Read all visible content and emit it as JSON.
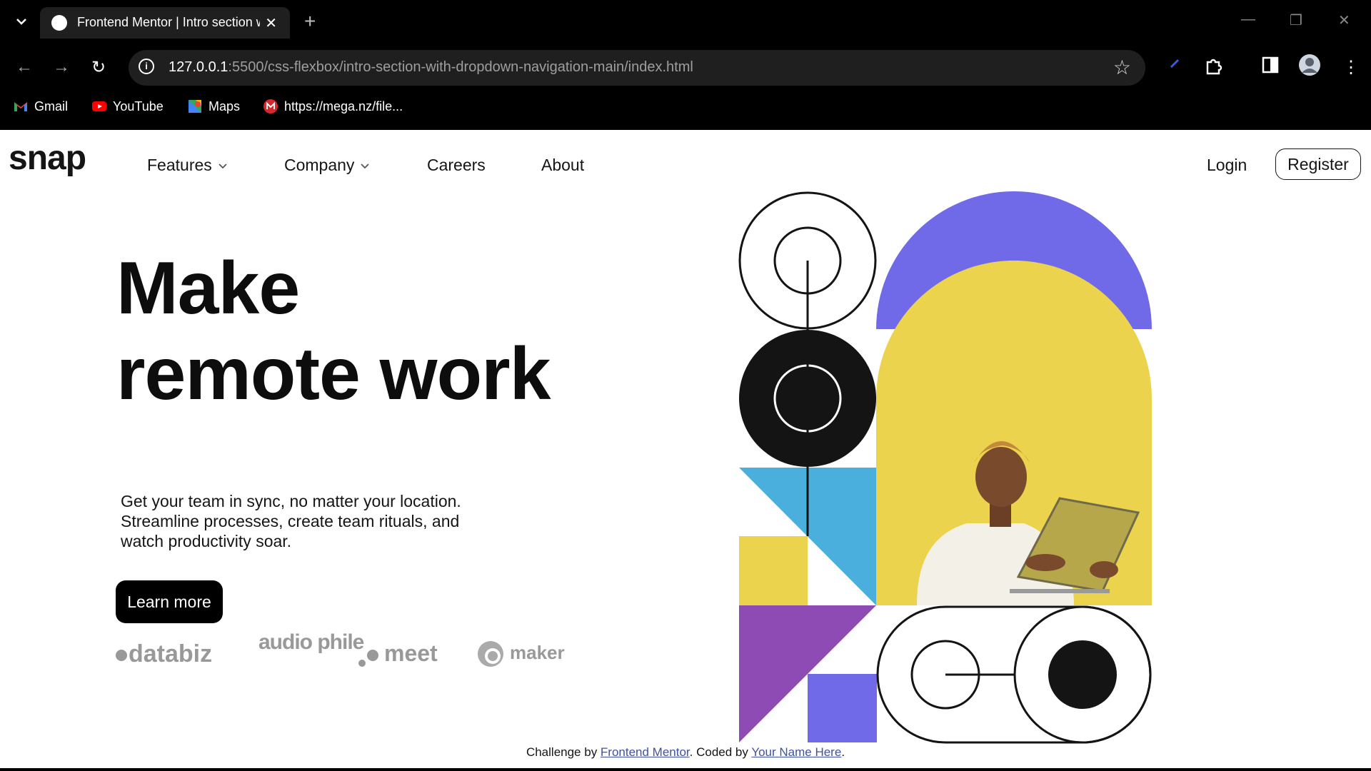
{
  "browser": {
    "tab_title": "Frontend Mentor | Intro section with dropdown navigation",
    "url_host": "127.0.0.1",
    "url_rest": ":5500/css-flexbox/intro-section-with-dropdown-navigation-main/index.html",
    "bookmarks": [
      {
        "label": "Gmail",
        "icon": "gmail-icon"
      },
      {
        "label": "YouTube",
        "icon": "youtube-icon"
      },
      {
        "label": "Maps",
        "icon": "maps-icon"
      },
      {
        "label": "https://mega.nz/file...",
        "icon": "mega-icon"
      }
    ]
  },
  "header": {
    "logo": "snap",
    "nav": {
      "features": "Features",
      "company": "Company",
      "careers": "Careers",
      "about": "About"
    },
    "login": "Login",
    "register": "Register"
  },
  "hero": {
    "headline_line1": "Make",
    "headline_line2": "remote work",
    "description": "Get your team in sync, no matter your location. Streamline processes, create team rituals, and watch productivity soar.",
    "cta": "Learn more",
    "clients": [
      "databiz",
      "audio phile",
      "meet",
      "maker"
    ]
  },
  "footer": {
    "prefix": "Challenge by ",
    "link1": "Frontend Mentor",
    "middle": ". Coded by ",
    "link2": "Your Name Here",
    "suffix": "."
  },
  "colors": {
    "purple": "#7069e8",
    "yellow": "#ebd34d",
    "cyan": "#4bafdd",
    "violet": "#8e4bb4",
    "black": "#141414"
  }
}
